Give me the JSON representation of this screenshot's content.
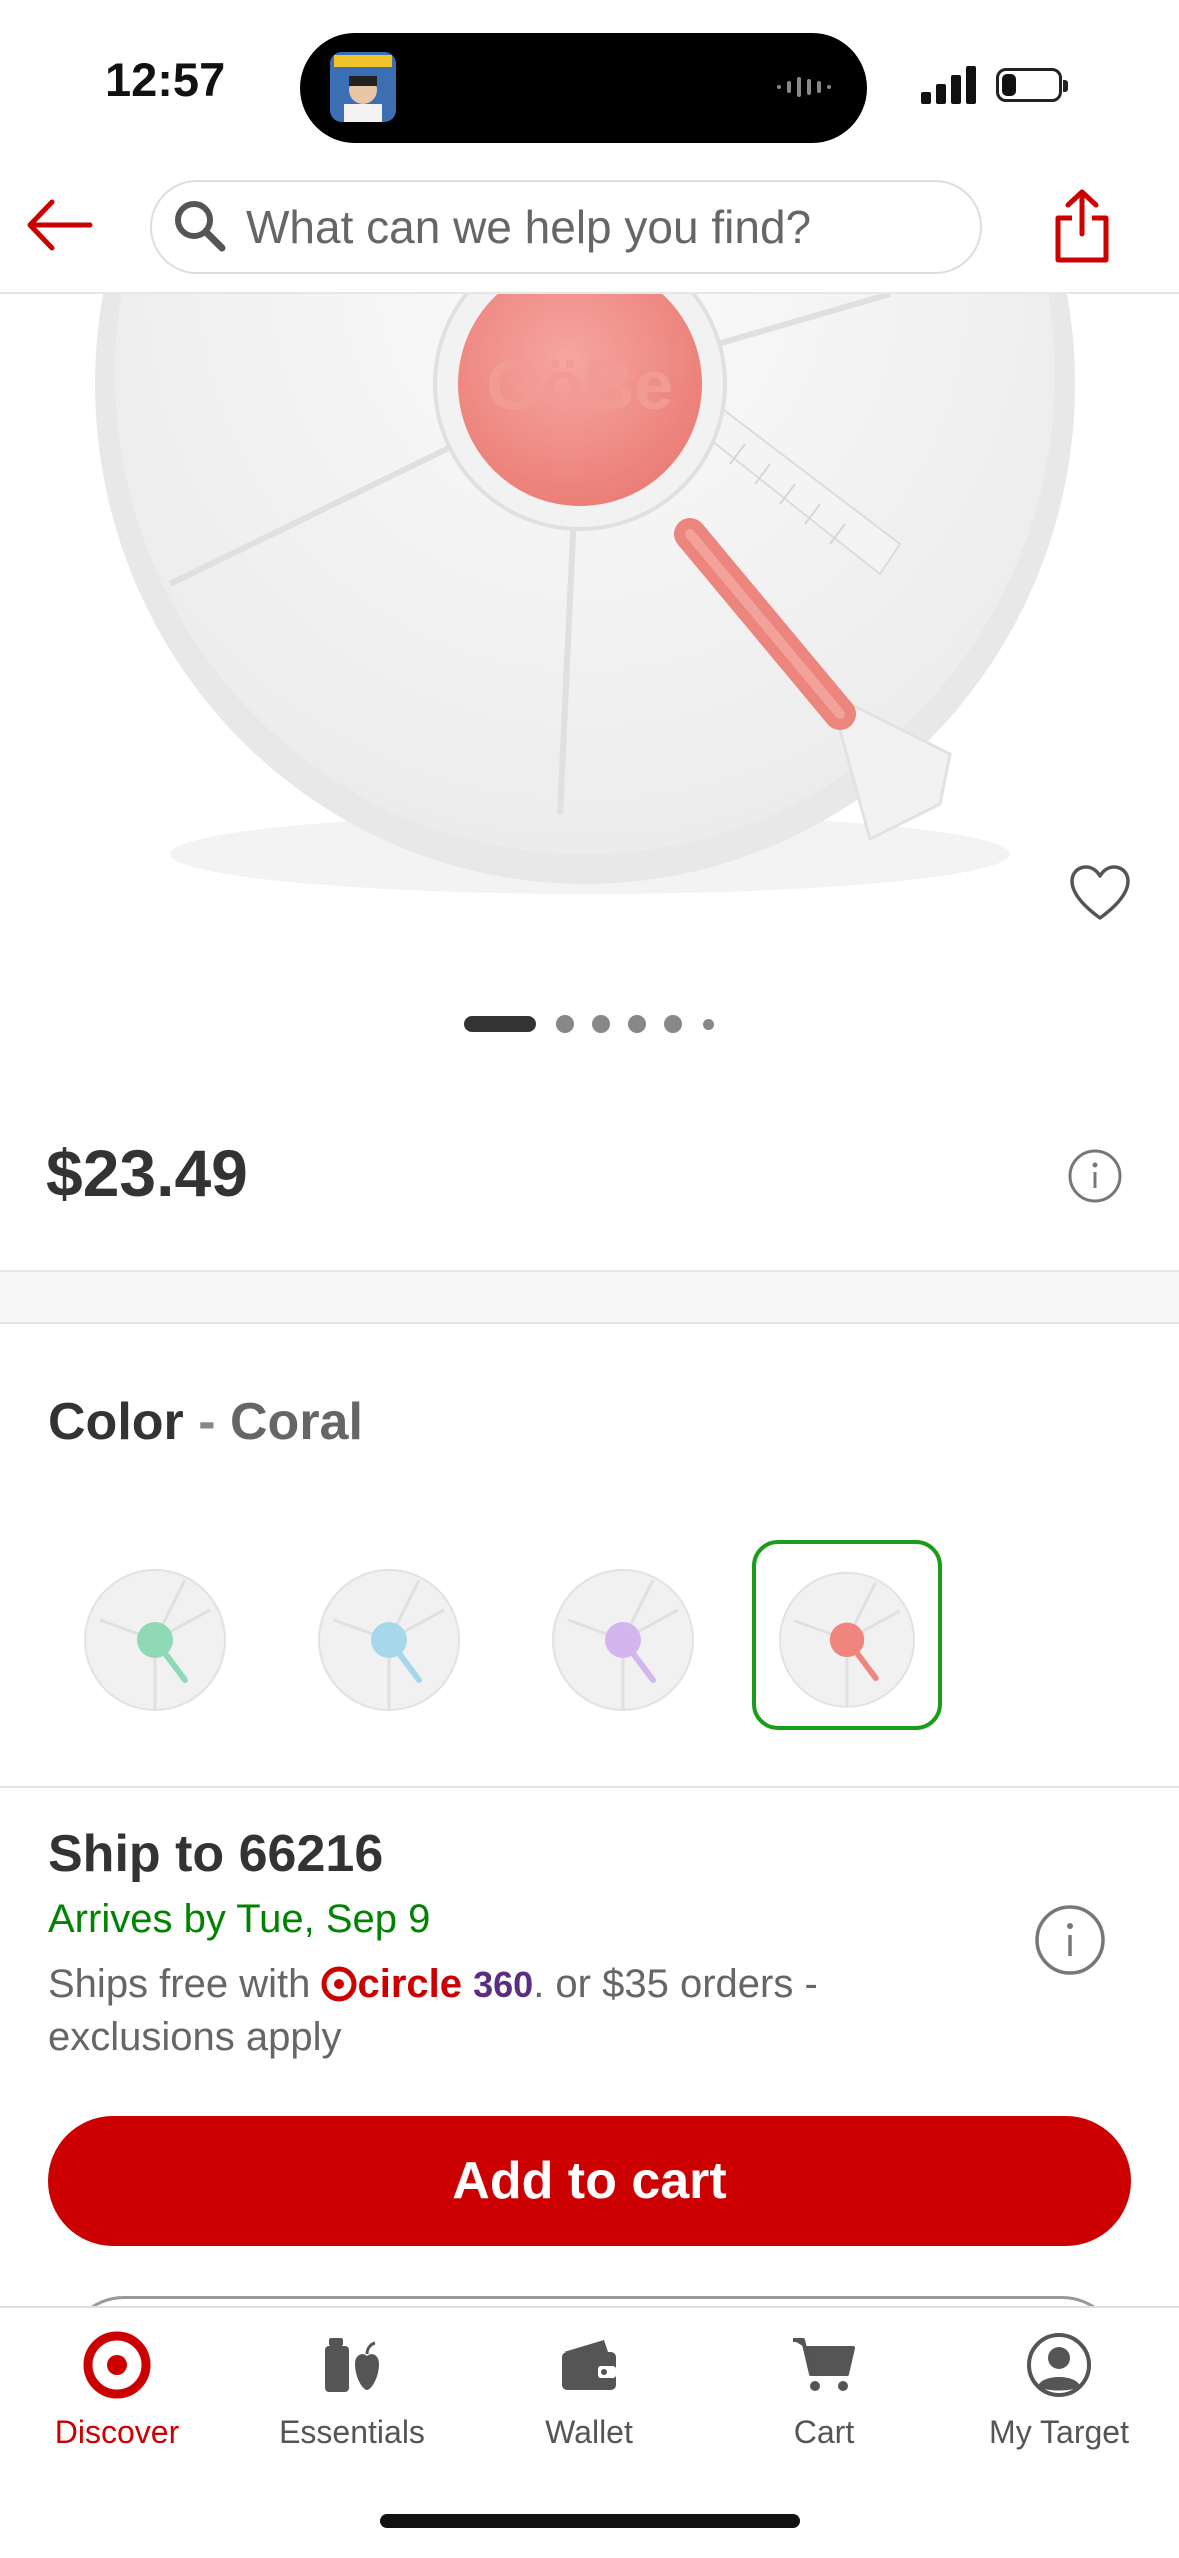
{
  "status_bar": {
    "time": "12:57"
  },
  "search": {
    "placeholder": "What can we help you find?"
  },
  "product": {
    "price": "$23.49",
    "image_dots_total": 6,
    "image_dots_active": 1
  },
  "color": {
    "label": "Color",
    "separator": "-",
    "selected": "Coral",
    "swatches": [
      {
        "name": "Mint",
        "accent": "#8fd9b6"
      },
      {
        "name": "Blue",
        "accent": "#a6d8ec"
      },
      {
        "name": "Lavender",
        "accent": "#d3b6ee"
      },
      {
        "name": "Coral",
        "accent": "#f0857d"
      }
    ]
  },
  "shipping": {
    "title": "Ship to 66216",
    "arrives": "Arrives by Tue, Sep 9",
    "free_prefix": "Ships free with",
    "circle_text": "circle",
    "circle_360": "360",
    "free_suffix": ". or $35 orders - exclusions apply"
  },
  "actions": {
    "add_to_cart": "Add to cart"
  },
  "bottom_nav": [
    {
      "label": "Discover",
      "icon": "target-bullseye-icon",
      "active": true
    },
    {
      "label": "Essentials",
      "icon": "essentials-icon",
      "active": false
    },
    {
      "label": "Wallet",
      "icon": "wallet-icon",
      "active": false
    },
    {
      "label": "Cart",
      "icon": "cart-icon",
      "active": false
    },
    {
      "label": "My Target",
      "icon": "account-icon",
      "active": false
    }
  ],
  "colors": {
    "brand_red": "#cc0000",
    "selected_outline": "#1a9e1a",
    "arrival_green": "#008300",
    "circle_purple": "#5a2d82"
  }
}
